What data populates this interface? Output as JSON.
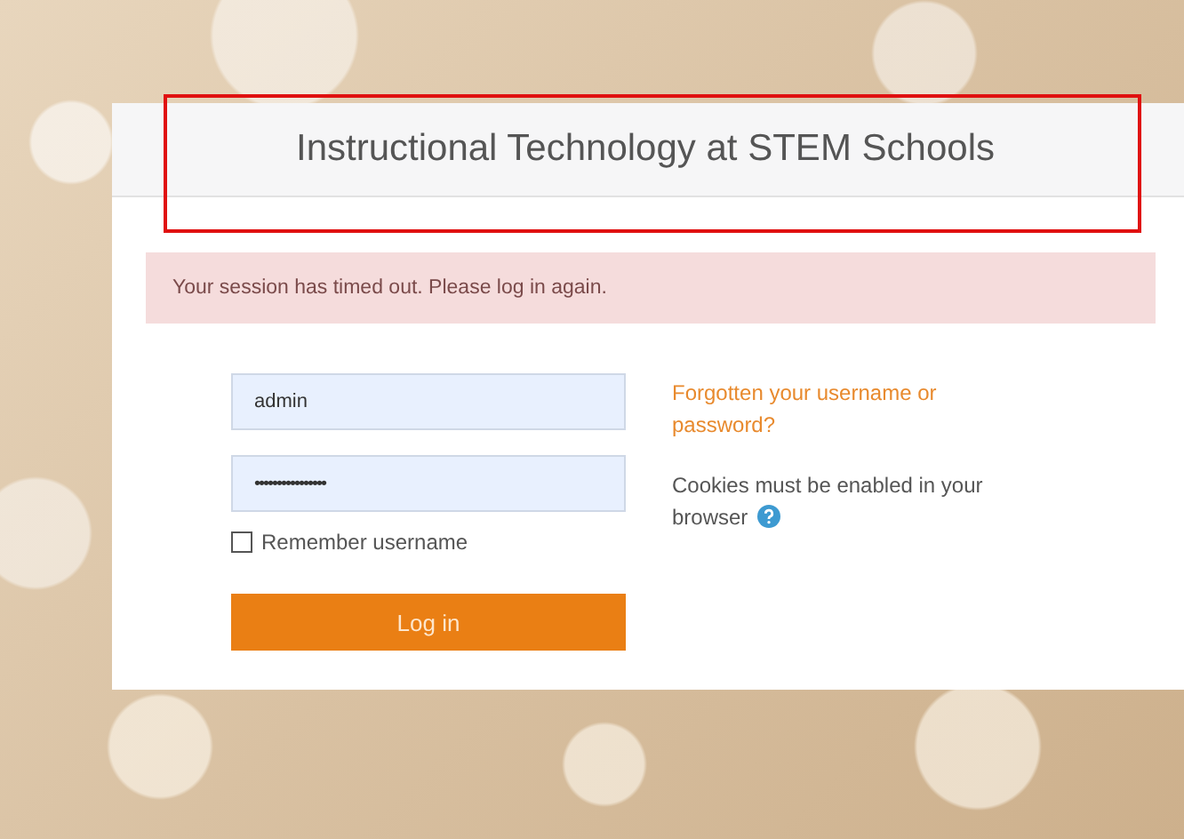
{
  "header": {
    "title": "Instructional Technology at STEM Schools",
    "highlighted": true
  },
  "alert": {
    "message": "Your session has timed out. Please log in again."
  },
  "form": {
    "username": "admin",
    "password": "••••••••••••••••",
    "remember": {
      "label": "Remember username",
      "checked": false
    },
    "submit": "Log in"
  },
  "help": {
    "forgot_link": "Forgotten your username or password?",
    "cookies_note": "Cookies must be enabled in your browser"
  }
}
